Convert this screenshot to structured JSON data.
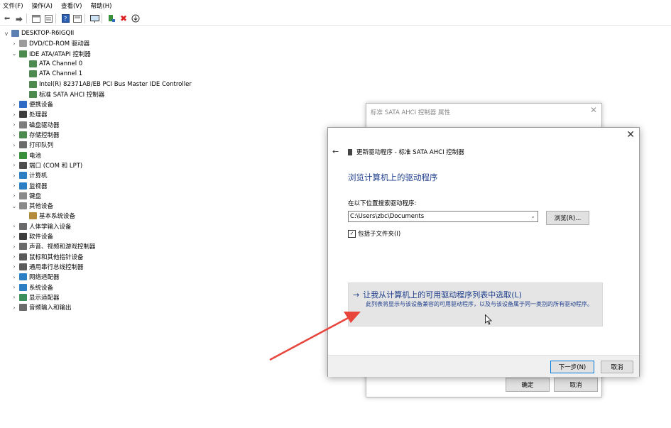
{
  "menu": [
    "文件(F)",
    "操作(A)",
    "查看(V)",
    "帮助(H)"
  ],
  "toolbar": {
    "icons": [
      "back-icon",
      "forward-icon",
      "properties-icon",
      "list-icon",
      "help-icon",
      "view-icon",
      "monitor-icon",
      "scan-icon",
      "uninstall-icon",
      "download-icon"
    ]
  },
  "tree": {
    "root": "DESKTOP-R6IGQII",
    "items": [
      {
        "label": "DVD/CD-ROM 驱动器",
        "exp": ">",
        "level": 1,
        "color": "#9b9b9b"
      },
      {
        "label": "IDE ATA/ATAPI 控制器",
        "exp": "v",
        "level": 1,
        "color": "#4d8a4d"
      },
      {
        "label": "ATA Channel 0",
        "exp": "",
        "level": 2,
        "color": "#4d8a4d"
      },
      {
        "label": "ATA Channel 1",
        "exp": "",
        "level": 2,
        "color": "#4d8a4d"
      },
      {
        "label": "Intel(R) 82371AB/EB PCI Bus Master IDE Controller",
        "exp": "",
        "level": 2,
        "color": "#4d8a4d"
      },
      {
        "label": "标准 SATA AHCI 控制器",
        "exp": "",
        "level": 2,
        "color": "#4d8a4d"
      },
      {
        "label": "便携设备",
        "exp": ">",
        "level": 1,
        "color": "#2d6bc4"
      },
      {
        "label": "处理器",
        "exp": ">",
        "level": 1,
        "color": "#3c3c3c"
      },
      {
        "label": "磁盘驱动器",
        "exp": ">",
        "level": 1,
        "color": "#7d7d7d"
      },
      {
        "label": "存储控制器",
        "exp": ">",
        "level": 1,
        "color": "#4d8a4d"
      },
      {
        "label": "打印队列",
        "exp": ">",
        "level": 1,
        "color": "#6b6b6b"
      },
      {
        "label": "电池",
        "exp": ">",
        "level": 1,
        "color": "#3a8f3a"
      },
      {
        "label": "端口 (COM 和 LPT)",
        "exp": ">",
        "level": 1,
        "color": "#4d4d4d"
      },
      {
        "label": "计算机",
        "exp": ">",
        "level": 1,
        "color": "#2d7fc4"
      },
      {
        "label": "监视器",
        "exp": ">",
        "level": 1,
        "color": "#2d7fc4"
      },
      {
        "label": "键盘",
        "exp": ">",
        "level": 1,
        "color": "#8a8a8a"
      },
      {
        "label": "其他设备",
        "exp": "v",
        "level": 1,
        "color": "#8a8a8a"
      },
      {
        "label": "基本系统设备",
        "exp": "",
        "level": 2,
        "color": "#b58a3a"
      },
      {
        "label": "人体学输入设备",
        "exp": ">",
        "level": 1,
        "color": "#6b6b6b"
      },
      {
        "label": "软件设备",
        "exp": ">",
        "level": 1,
        "color": "#3c3c3c"
      },
      {
        "label": "声音、视频和游戏控制器",
        "exp": ">",
        "level": 1,
        "color": "#6b6b6b"
      },
      {
        "label": "鼠标和其他指针设备",
        "exp": ">",
        "level": 1,
        "color": "#5a5a5a"
      },
      {
        "label": "通用串行总线控制器",
        "exp": ">",
        "level": 1,
        "color": "#5a5a5a"
      },
      {
        "label": "网络适配器",
        "exp": ">",
        "level": 1,
        "color": "#2d7fc4"
      },
      {
        "label": "系统设备",
        "exp": ">",
        "level": 1,
        "color": "#2d7fc4"
      },
      {
        "label": "显示适配器",
        "exp": ">",
        "level": 1,
        "color": "#3a8f5a"
      },
      {
        "label": "音频输入和输出",
        "exp": ">",
        "level": 1,
        "color": "#6b6b6b"
      }
    ]
  },
  "props_dialog": {
    "title": "标准 SATA AHCI 控制器 属性",
    "ok_label": "确定",
    "cancel_label": "取消"
  },
  "update_dialog": {
    "header": "更新驱动程序 - 标准 SATA AHCI 控制器",
    "heading": "浏览计算机上的驱动程序",
    "search_label": "在以下位置搜索驱动程序:",
    "path_value": "C:\\Users\\zbc\\Documents",
    "browse_label": "浏览(R)...",
    "subfolders_label": "包括子文件夹(I)",
    "subfolders_checked": true,
    "pick_link": "让我从计算机上的可用驱动程序列表中选取(L)",
    "pick_desc": "此列表将显示与该设备兼容的可用驱动程序，以及与该设备属于同一类别的所有驱动程序。",
    "next_label": "下一步(N)",
    "cancel_label": "取消"
  },
  "colors": {
    "accent_blue": "#1e3e8c",
    "arrow_red": "#e8453c",
    "primary_border": "#0078d7"
  }
}
